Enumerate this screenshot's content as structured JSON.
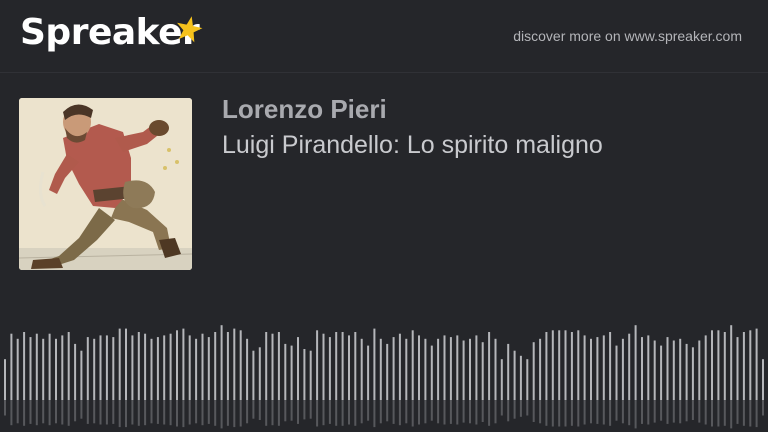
{
  "header": {
    "logo_text": "Spreaker",
    "logo_star_icon": "star-icon",
    "discover_text": "discover more on www.spreaker.com"
  },
  "episode": {
    "author": "Lorenzo Pieri",
    "title": "Luigi Pirandello: Lo spirito maligno",
    "cover_icon": "episode-cover-illustration"
  },
  "colors": {
    "background": "#25262a",
    "accent_star": "#f6c21c",
    "waveform": "#b5b6ba"
  },
  "waveform": {
    "levels": [
      0.48,
      0.78,
      0.72,
      0.8,
      0.74,
      0.78,
      0.72,
      0.78,
      0.72,
      0.76,
      0.8,
      0.66,
      0.58,
      0.74,
      0.72,
      0.76,
      0.76,
      0.74,
      0.84,
      0.84,
      0.76,
      0.8,
      0.78,
      0.72,
      0.74,
      0.76,
      0.78,
      0.82,
      0.84,
      0.76,
      0.72,
      0.78,
      0.74,
      0.8,
      0.88,
      0.8,
      0.84,
      0.82,
      0.72,
      0.58,
      0.62,
      0.8,
      0.78,
      0.8,
      0.66,
      0.64,
      0.74,
      0.6,
      0.58,
      0.82,
      0.78,
      0.74,
      0.8,
      0.8,
      0.76,
      0.8,
      0.72,
      0.64,
      0.84,
      0.72,
      0.66,
      0.74,
      0.78,
      0.72,
      0.82,
      0.76,
      0.72,
      0.64,
      0.72,
      0.76,
      0.74,
      0.76,
      0.7,
      0.72,
      0.76,
      0.68,
      0.8,
      0.72,
      0.48,
      0.66,
      0.58,
      0.52,
      0.48,
      0.68,
      0.72,
      0.8,
      0.82,
      0.82,
      0.82,
      0.8,
      0.82,
      0.76,
      0.72,
      0.74,
      0.76,
      0.8,
      0.64,
      0.72,
      0.78,
      0.88,
      0.74,
      0.76,
      0.7,
      0.64,
      0.74,
      0.7,
      0.72,
      0.66,
      0.62,
      0.7,
      0.76,
      0.82,
      0.82,
      0.8,
      0.88,
      0.74,
      0.8,
      0.82,
      0.84,
      0.48
    ]
  }
}
